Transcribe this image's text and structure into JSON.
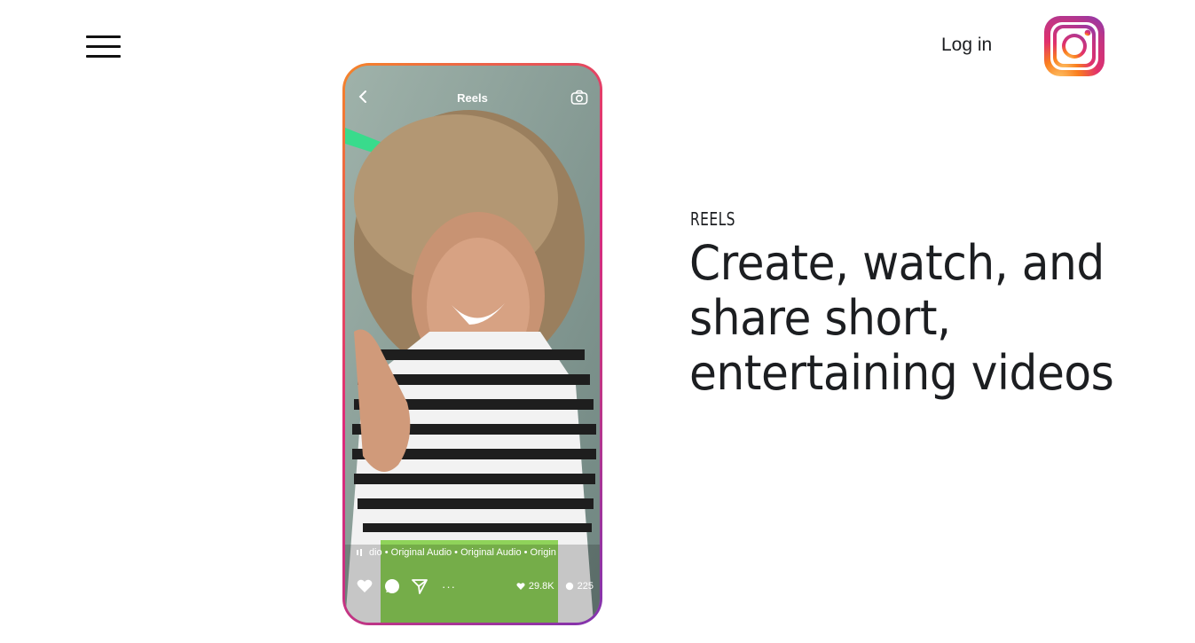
{
  "header": {
    "login_label": "Log in"
  },
  "icons": {
    "menu": "hamburger-menu-icon",
    "logo": "instagram-logo"
  },
  "phone": {
    "title": "Reels",
    "audio_text": "dio • Original Audio • Original Audio • Origin",
    "likes": "29.8K",
    "comments": "225",
    "more": "···"
  },
  "feature": {
    "label": "REELS",
    "headline": "Create, watch, and share short, entertaining videos"
  },
  "colors": {
    "gradient": [
      "#f58529",
      "#dd2a7b",
      "#8134af"
    ],
    "text": "#1c1e21"
  }
}
